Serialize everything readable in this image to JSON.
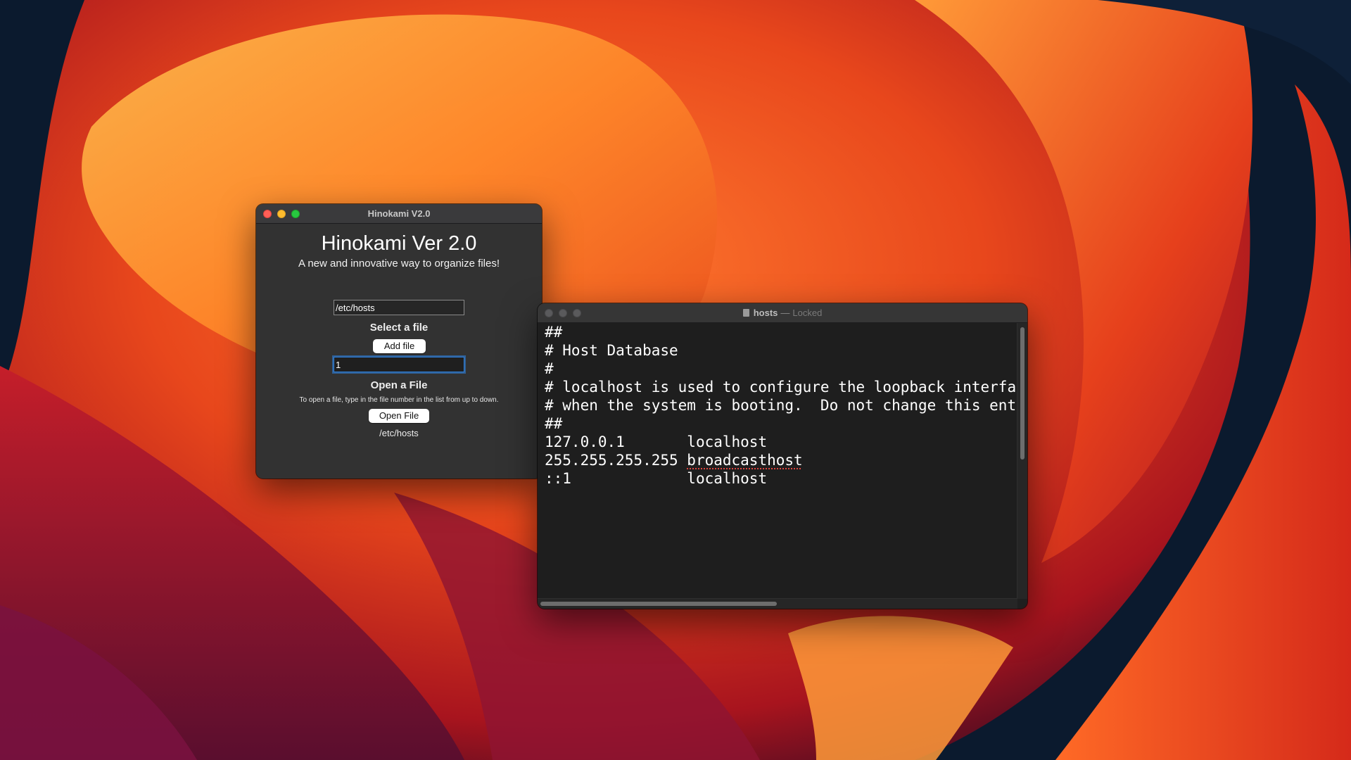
{
  "desktop": {
    "wallpaper": "macOS Ventura orange wallpaper",
    "colors": {
      "deep": "#0b1a2e",
      "orange": "#f05a22",
      "red": "#c8201c",
      "yellow": "#ffb34a",
      "magenta": "#8a1a4a"
    }
  },
  "hinokami_window": {
    "title": "Hinokami V2.0",
    "heading": "Hinokami Ver 2.0",
    "subtitle": "A new and innovative way to organize files!",
    "path_input_value": "/etc/hosts",
    "select_label": "Select a file",
    "add_button": "Add file",
    "number_input_value": "1",
    "open_label": "Open a File",
    "open_hint": "To open a file, type in the file number in the list from up to down.",
    "open_button": "Open File",
    "result_text": "/etc/hosts"
  },
  "hosts_window": {
    "file_name": "hosts",
    "separator": "—",
    "state": "Locked",
    "lines": {
      "l1": "##",
      "l2": "# Host Database",
      "l3": "#",
      "l4": "# localhost is used to configure the loopback interface",
      "l5": "# when the system is booting.  Do not change this entry.",
      "l6": "##",
      "l7_ip": "127.0.0.1       ",
      "l7_host": "localhost",
      "l8_ip": "255.255.255.255 ",
      "l8_host": "broadcasthost",
      "l9_ip": "::1             ",
      "l9_host": "localhost"
    }
  }
}
